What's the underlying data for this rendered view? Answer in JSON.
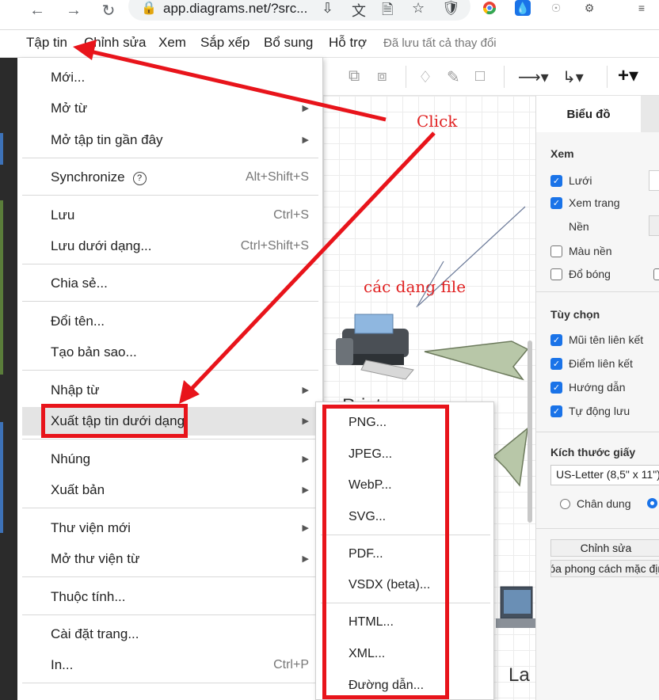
{
  "browser": {
    "url": "app.diagrams.net/?src...",
    "nav": [
      "arrow-left-icon",
      "arrow-right-icon",
      "reload-icon"
    ],
    "extensions": [
      "chrome-icon",
      "water-drop-icon",
      "compass-icon",
      "puzzle-icon",
      "reading-list-icon"
    ]
  },
  "menubar": {
    "items": [
      "Tập tin",
      "Chỉnh sửa",
      "Xem",
      "Sắp xếp",
      "Bổ sung",
      "Hỗ trợ"
    ],
    "status": "Đã lưu tất cả thay đổi"
  },
  "file_menu": {
    "items": [
      {
        "label": "Mới...",
        "shortcut": "",
        "submenu": false
      },
      {
        "label": "Mở từ",
        "shortcut": "",
        "submenu": true
      },
      {
        "label": "Mở tập tin gần đây",
        "shortcut": "",
        "submenu": true
      },
      {
        "label": "Synchronize",
        "shortcut": "Alt+Shift+S",
        "submenu": false
      },
      {
        "label": "Lưu",
        "shortcut": "Ctrl+S",
        "submenu": false
      },
      {
        "label": "Lưu dưới dạng...",
        "shortcut": "Ctrl+Shift+S",
        "submenu": false
      },
      {
        "label": "Chia sẻ...",
        "shortcut": "",
        "submenu": false
      },
      {
        "label": "Đổi tên...",
        "shortcut": "",
        "submenu": false
      },
      {
        "label": "Tạo bản sao...",
        "shortcut": "",
        "submenu": false
      },
      {
        "label": "Nhập từ",
        "shortcut": "",
        "submenu": true
      },
      {
        "label": "Xuất tập tin dưới dạng",
        "shortcut": "",
        "submenu": true
      },
      {
        "label": "Nhúng",
        "shortcut": "",
        "submenu": true
      },
      {
        "label": "Xuất bản",
        "shortcut": "",
        "submenu": true
      },
      {
        "label": "Thư viện mới",
        "shortcut": "",
        "submenu": true
      },
      {
        "label": "Mở thư viện từ",
        "shortcut": "",
        "submenu": true
      },
      {
        "label": "Thuộc tính...",
        "shortcut": "",
        "submenu": false
      },
      {
        "label": "Cài đặt trang...",
        "shortcut": "",
        "submenu": false
      },
      {
        "label": "In...",
        "shortcut": "Ctrl+P",
        "submenu": false
      }
    ]
  },
  "export_submenu": {
    "items": [
      "PNG...",
      "JPEG...",
      "WebP...",
      "SVG...",
      "PDF...",
      "VSDX (beta)...",
      "HTML...",
      "XML...",
      "Đường dẫn..."
    ]
  },
  "format_panel": {
    "tab": "Biểu đồ",
    "view_heading": "Xem",
    "grid": "Lưới",
    "page_view": "Xem trang",
    "background": "Nền",
    "background_color": "Màu nền",
    "shadow": "Đổ bóng",
    "options_heading": "Tùy chọn",
    "connection_arrows": "Mũi tên liên kết",
    "connection_points": "Điểm liên kết",
    "guides": "Hướng dẫn",
    "autosave": "Tự động lưu",
    "paper_heading": "Kích thước giấy",
    "paper_size": "US-Letter (8,5\" x 11\")",
    "portrait": "Chân dung",
    "edit_button": "Chỉnh sửa",
    "clear_style_button": "Xóa phong cách mặc định"
  },
  "canvas": {
    "label_bottom_1": "Print",
    "label_bottom_2": "La"
  },
  "annotations": {
    "click": "Click",
    "file_types": "các dạng file"
  },
  "colors": {
    "annotation": "#e8141b",
    "accent": "#1a73e8"
  }
}
